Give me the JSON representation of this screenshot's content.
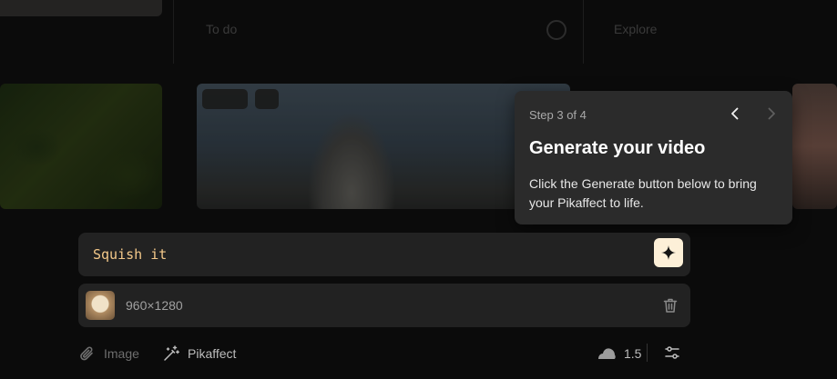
{
  "background": {
    "col_labels": [
      "To do",
      "Explore"
    ]
  },
  "tour": {
    "step": "Step 3 of 4",
    "title": "Generate your video",
    "body": "Click the Generate button below to bring your Pikaffect to life.",
    "prev_icon": "chevron-left-icon",
    "next_icon": "chevron-right-icon"
  },
  "prompt": {
    "value": "Squish it",
    "generate_icon": "sparkle-icon",
    "generate_color": "#fdf0d8"
  },
  "attachment": {
    "dimensions": "960×1280",
    "delete_icon": "trash-icon"
  },
  "toolbar": {
    "image_label": "Image",
    "pikaffect_label": "Pikaffect",
    "credits": "1.5",
    "settings_icon": "sliders-icon"
  },
  "colors": {
    "prompt_text": "#f4c98a",
    "panel_bg": "#222222",
    "popover_bg": "#2b2b2b"
  }
}
